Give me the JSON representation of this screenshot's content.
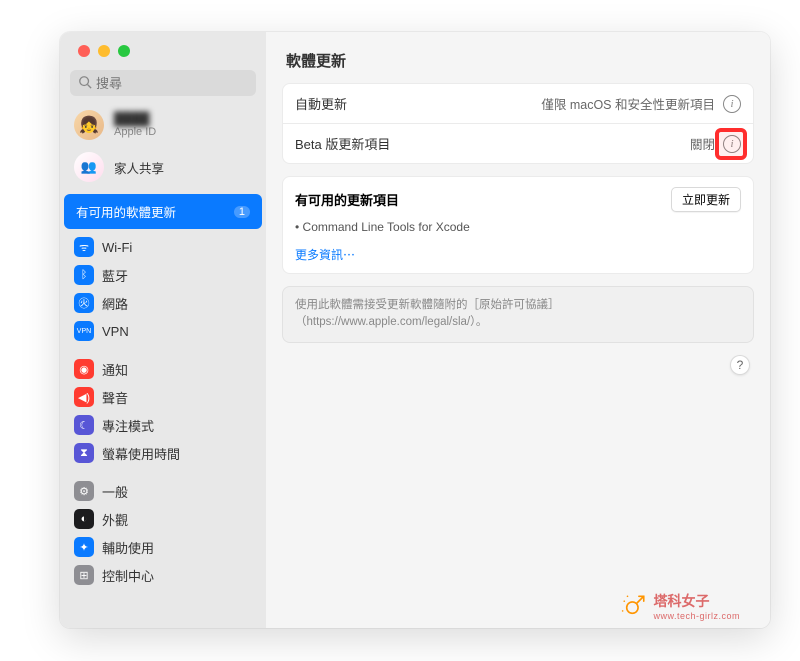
{
  "search": {
    "placeholder": "搜尋"
  },
  "account": {
    "name": "████",
    "sub": "Apple ID"
  },
  "family": {
    "label": "家人共享"
  },
  "highlighted_section": {
    "label": "有可用的軟體更新",
    "count": "1"
  },
  "nav": [
    {
      "label": "Wi-Fi",
      "icon": "wifi"
    },
    {
      "label": "藍牙",
      "icon": "bt"
    },
    {
      "label": "網路",
      "icon": "net"
    },
    {
      "label": "VPN",
      "icon": "vpn"
    },
    {
      "gap": true
    },
    {
      "label": "通知",
      "icon": "notif"
    },
    {
      "label": "聲音",
      "icon": "sound"
    },
    {
      "label": "專注模式",
      "icon": "focus"
    },
    {
      "label": "螢幕使用時間",
      "icon": "screen"
    },
    {
      "gap": true
    },
    {
      "label": "一般",
      "icon": "gen"
    },
    {
      "label": "外觀",
      "icon": "appear"
    },
    {
      "label": "輔助使用",
      "icon": "access"
    },
    {
      "label": "控制中心",
      "icon": "ctrl"
    }
  ],
  "page_title": "軟體更新",
  "auto_update": {
    "label": "自動更新",
    "value": "僅限 macOS 和安全性更新項目"
  },
  "beta_update": {
    "label": "Beta 版更新項目",
    "value": "關閉"
  },
  "available": {
    "title": "有可用的更新項目",
    "button": "立即更新",
    "items": [
      "Command Line Tools for Xcode"
    ],
    "more": "更多資訊⋯"
  },
  "license": "使用此軟體需接受更新軟體隨附的［原始許可協議］（https://www.apple.com/legal/sla/）。",
  "help": "?",
  "watermark": {
    "brand": "塔科女子",
    "url": "www.tech-girlz.com"
  },
  "icon_glyphs": {
    "wifi": "ᯤ",
    "bt": "ᛒ",
    "net": "㊋",
    "vpn": "VPN",
    "notif": "◉",
    "sound": "◀)",
    "focus": "☾",
    "screen": "⧗",
    "gen": "⚙",
    "appear": "◐",
    "access": "✦",
    "ctrl": "⊞"
  }
}
